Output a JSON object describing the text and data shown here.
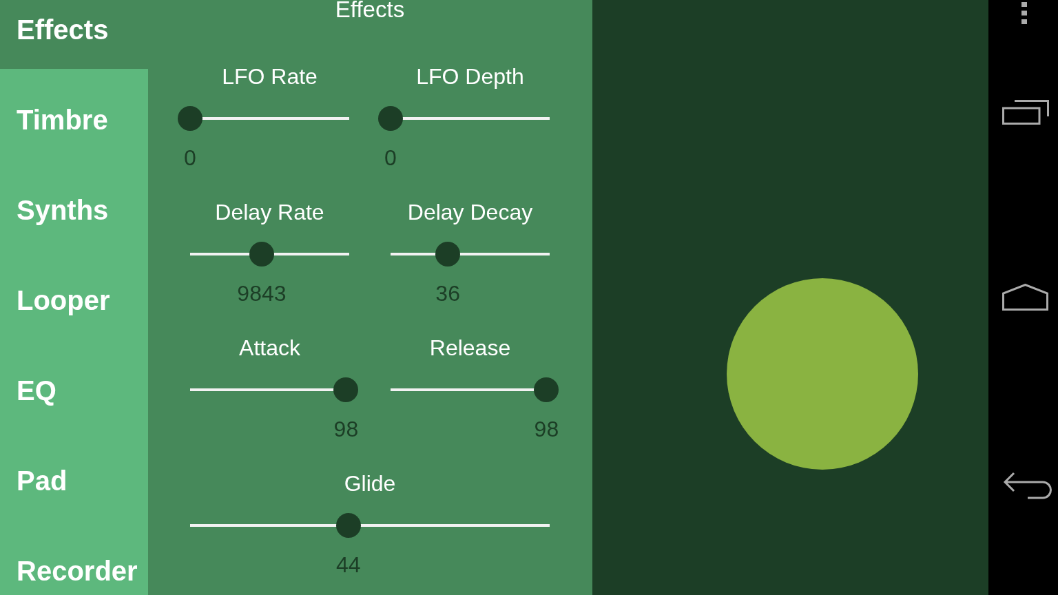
{
  "sidebar": {
    "items": [
      {
        "label": "Effects",
        "selected": true
      },
      {
        "label": "Timbre",
        "selected": false
      },
      {
        "label": "Synths",
        "selected": false
      },
      {
        "label": "Looper",
        "selected": false
      },
      {
        "label": "EQ",
        "selected": false
      },
      {
        "label": "Pad",
        "selected": false
      },
      {
        "label": "Recorder",
        "selected": false
      }
    ]
  },
  "panel": {
    "title": "Effects",
    "rows": [
      [
        {
          "label": "LFO Rate",
          "level": 0,
          "value": "0"
        },
        {
          "label": "LFO Depth",
          "level": 0,
          "value": "0"
        }
      ],
      [
        {
          "label": "Delay Rate",
          "level": 0.45,
          "value": "9843"
        },
        {
          "label": "Delay Decay",
          "level": 0.36,
          "value": "36"
        }
      ],
      [
        {
          "label": "Attack",
          "level": 0.98,
          "value": "98"
        },
        {
          "label": "Release",
          "level": 0.98,
          "value": "98"
        }
      ],
      [
        {
          "label": "Glide",
          "level": 0.44,
          "value": "44"
        }
      ]
    ]
  }
}
